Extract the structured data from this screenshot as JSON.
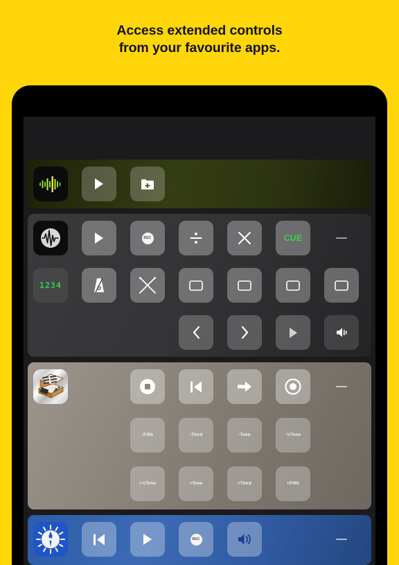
{
  "headline": {
    "line1": "Access extended controls",
    "line2": "from your favourite apps."
  },
  "theme": {
    "background": "#FFD60A",
    "device_frame": "#000000",
    "screen": "#1b1b1d",
    "accent_green": "#35d94a",
    "panel_audio": "#353d14",
    "panel_dark": "#343436",
    "panel_warm": "#8d877e",
    "panel_blue": "#3c6bb4"
  },
  "panels": [
    {
      "id": "audio-recorder",
      "app_icon": "waveform-app-icon",
      "background": "#353d14",
      "rows": [
        {
          "buttons": [
            {
              "icon": "play-icon",
              "label": ""
            },
            {
              "icon": "folder-add-icon",
              "label": ""
            }
          ]
        }
      ]
    },
    {
      "id": "daw-controller",
      "app_icon": "waveform-circle-app-icon",
      "background": "#343436",
      "rows": [
        {
          "buttons": [
            {
              "icon": "play-icon",
              "label": ""
            },
            {
              "icon": "record-rec-icon",
              "label": "REC"
            },
            {
              "icon": "divide-icon",
              "label": ""
            },
            {
              "icon": "multiply-icon",
              "label": ""
            },
            {
              "icon": "cue-text-icon",
              "label": "CUE"
            },
            {
              "icon": "minus-icon",
              "label": ""
            }
          ]
        },
        {
          "buttons": [
            {
              "icon": "led-digits-display",
              "label": "1234"
            },
            {
              "icon": "metronome-icon",
              "label": ""
            },
            {
              "icon": "crossed-sticks-icon",
              "label": ""
            },
            {
              "icon": "rounded-rect-icon",
              "label": ""
            },
            {
              "icon": "rounded-rect-icon",
              "label": ""
            },
            {
              "icon": "rounded-rect-icon",
              "label": ""
            },
            {
              "icon": "rounded-rect-icon",
              "label": ""
            }
          ]
        },
        {
          "buttons": [
            {
              "icon": "chevron-left-icon",
              "label": ""
            },
            {
              "icon": "chevron-right-icon",
              "label": ""
            },
            {
              "icon": "play-icon",
              "label": ""
            },
            {
              "icon": "speaker-icon",
              "label": ""
            }
          ]
        }
      ]
    },
    {
      "id": "synth-controller",
      "app_icon": "synthesizer-app-icon",
      "background": "#8d877e",
      "rows": [
        {
          "buttons": [
            {
              "icon": "stop-icon",
              "label": ""
            },
            {
              "icon": "skip-back-icon",
              "label": ""
            },
            {
              "icon": "arrow-right-icon",
              "label": ""
            },
            {
              "icon": "record-circle-icon",
              "label": ""
            },
            {
              "icon": "minus-icon",
              "label": ""
            }
          ]
        },
        {
          "buttons": [
            {
              "icon": "interval-button",
              "label": "-Fifth"
            },
            {
              "icon": "interval-button",
              "label": "-Third"
            },
            {
              "icon": "interval-button",
              "label": "-Tone"
            },
            {
              "icon": "interval-button",
              "label": "-½Tone"
            }
          ]
        },
        {
          "buttons": [
            {
              "icon": "interval-button",
              "label": "+½Tone"
            },
            {
              "icon": "interval-button",
              "label": "+Tone"
            },
            {
              "icon": "interval-button",
              "label": "+Third"
            },
            {
              "icon": "interval-button",
              "label": "+Fifth"
            }
          ]
        }
      ]
    },
    {
      "id": "tuner-controller",
      "app_icon": "tuner-dial-app-icon",
      "background": "#3c6bb4",
      "rows": [
        {
          "buttons": [
            {
              "icon": "skip-back-icon",
              "label": ""
            },
            {
              "icon": "play-icon",
              "label": ""
            },
            {
              "icon": "record-rec-icon",
              "label": "REC"
            },
            {
              "icon": "speaker-wave-icon",
              "label": ""
            },
            {
              "icon": "minus-icon",
              "label": ""
            }
          ]
        }
      ]
    }
  ]
}
